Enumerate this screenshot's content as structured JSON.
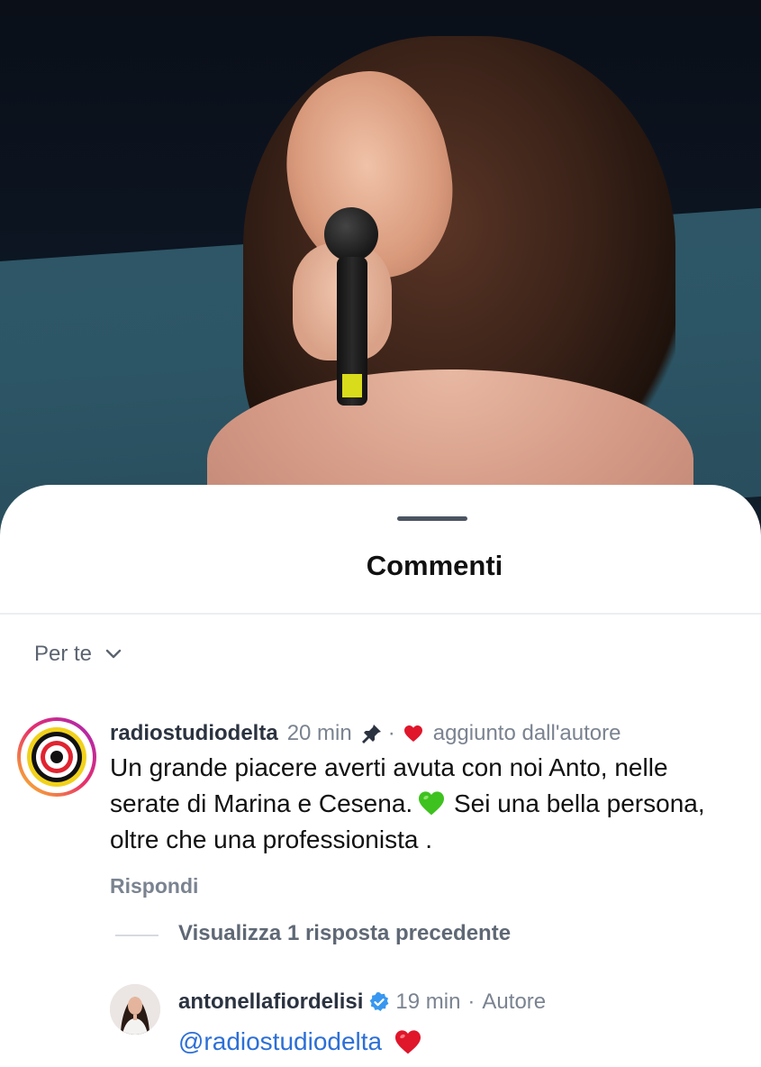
{
  "sheet": {
    "title": "Commenti",
    "filter_label": "Per te"
  },
  "comment": {
    "username": "radiostudiodelta",
    "time": "20 min",
    "separator": "·",
    "liked_by_author": "aggiunto dall'autore",
    "text": "Un grande piacere averti avuta con noi Anto, nelle serate di Marina e Cesena.",
    "text_after_emoji": " Sei una bella persona, oltre che una professionista .",
    "reply_label": "Rispondi",
    "view_replies_label": "Visualizza 1 risposta precedente"
  },
  "reply": {
    "username": "antonellafiordelisi",
    "time": "19 min",
    "separator": "·",
    "author_badge": "Autore",
    "text": "@radiostudiodelta"
  },
  "colors": {
    "link_blue": "#2d6fd6",
    "heart_red": "#e0162b",
    "verified_blue": "#3897f0",
    "green_heart": "#3ec21f"
  },
  "icons": [
    "pin-icon",
    "heart-icon",
    "chevron-down-icon",
    "verified-badge-icon",
    "green-heart-emoji",
    "red-heart-emoji"
  ]
}
